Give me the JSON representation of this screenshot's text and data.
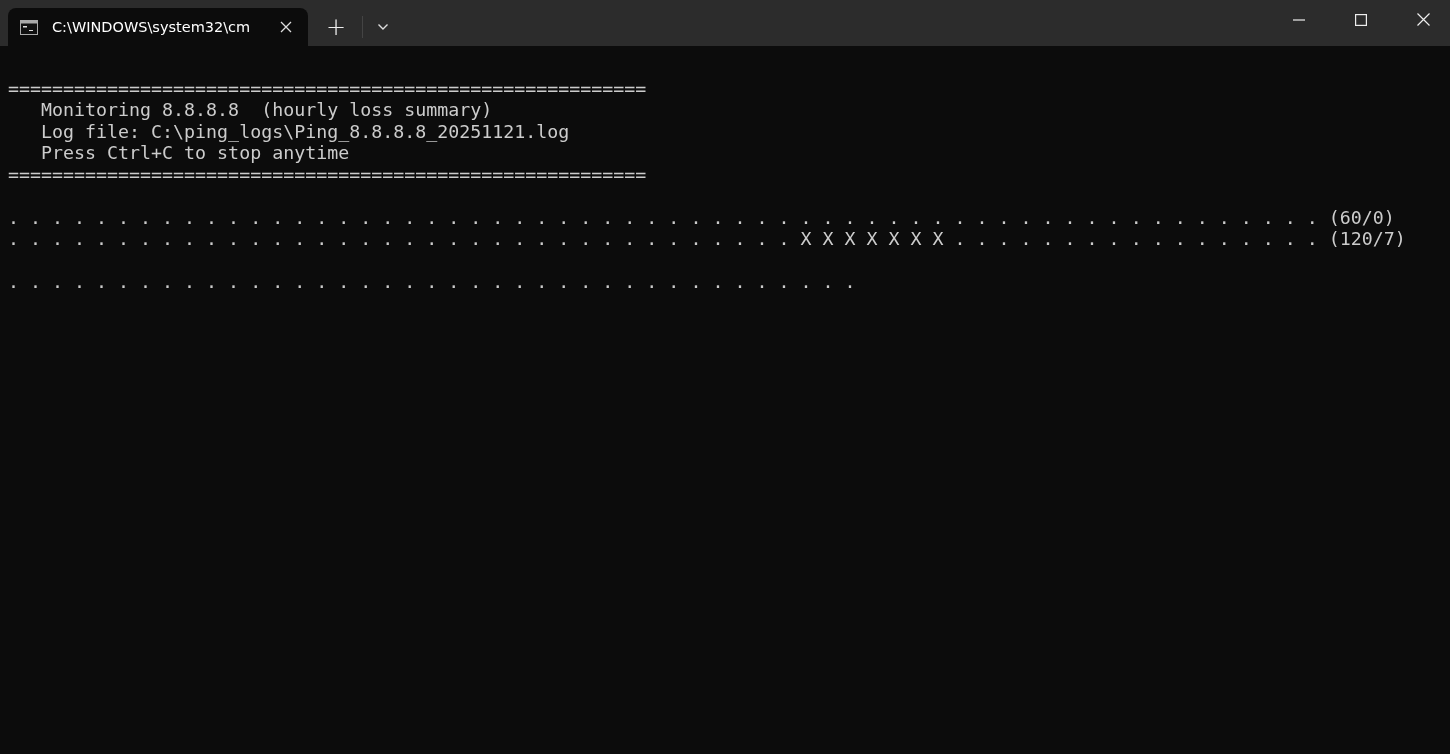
{
  "tabs": [
    {
      "title": "C:\\WINDOWS\\system32\\cm",
      "selected": true
    }
  ],
  "new_tab_button": "+",
  "terminal": {
    "blocks": [
      {
        "lines": [
          "==========================================================",
          "   Monitoring 8.8.8.8  (hourly loss summary)",
          "   Log file: C:\\ping_logs\\Ping_8.8.8.8_20251121.log",
          "   Press Ctrl+C to stop anytime",
          "=========================================================="
        ]
      },
      {
        "lines": [
          ". . . . . . . . . . . . . . . . . . . . . . . . . . . . . . . . . . . . . . . . . . . . . . . . . . . . . . . . . . . . (60/0)",
          ". . . . . . . . . . . . . . . . . . . . . . . . . . . . . . . . . . . . X X X X X X X . . . . . . . . . . . . . . . . . (120/7)"
        ]
      },
      {
        "lines": [
          ". . . . . . . . . . . . . . . . . . . . . . . . . . . . . . . . . . . . . . ."
        ]
      }
    ]
  }
}
